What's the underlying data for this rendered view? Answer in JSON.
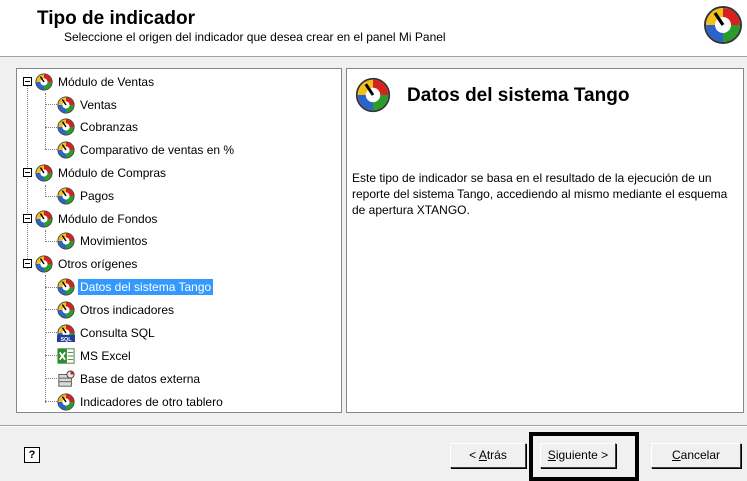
{
  "header": {
    "title": "Tipo de indicador",
    "subtitle": "Seleccione el origen del indicador que desea crear en el panel Mi Panel",
    "icon": "indicator-gauge-icon"
  },
  "tree": {
    "groups": [
      {
        "label": "Módulo de Ventas",
        "items": [
          "Ventas",
          "Cobranzas",
          "Comparativo de ventas en %"
        ]
      },
      {
        "label": "Módulo de Compras",
        "items": [
          "Pagos"
        ]
      },
      {
        "label": "Módulo de Fondos",
        "items": [
          "Movimientos"
        ]
      },
      {
        "label": "Otros orígenes",
        "items": [
          "Datos del sistema Tango",
          "Otros indicadores",
          "Consulta SQL",
          "MS Excel",
          "Base de datos externa",
          "Indicadores de otro tablero"
        ]
      }
    ],
    "selected": "Datos del sistema Tango"
  },
  "info": {
    "title": "Datos del sistema Tango",
    "description": "Este tipo de indicador se basa en el resultado de la ejecución de un reporte del sistema Tango, accediendo al mismo mediante el esquema de apertura XTANGO."
  },
  "buttons": {
    "back": {
      "prefix": "< ",
      "mnemonic": "A",
      "rest": "trás"
    },
    "next": {
      "mnemonic": "S",
      "rest": "iguiente >"
    },
    "cancel": {
      "mnemonic": "C",
      "rest": "ancelar"
    },
    "help": "?"
  },
  "colors": {
    "selection": "#3399ff",
    "background": "#f0f0f0"
  }
}
